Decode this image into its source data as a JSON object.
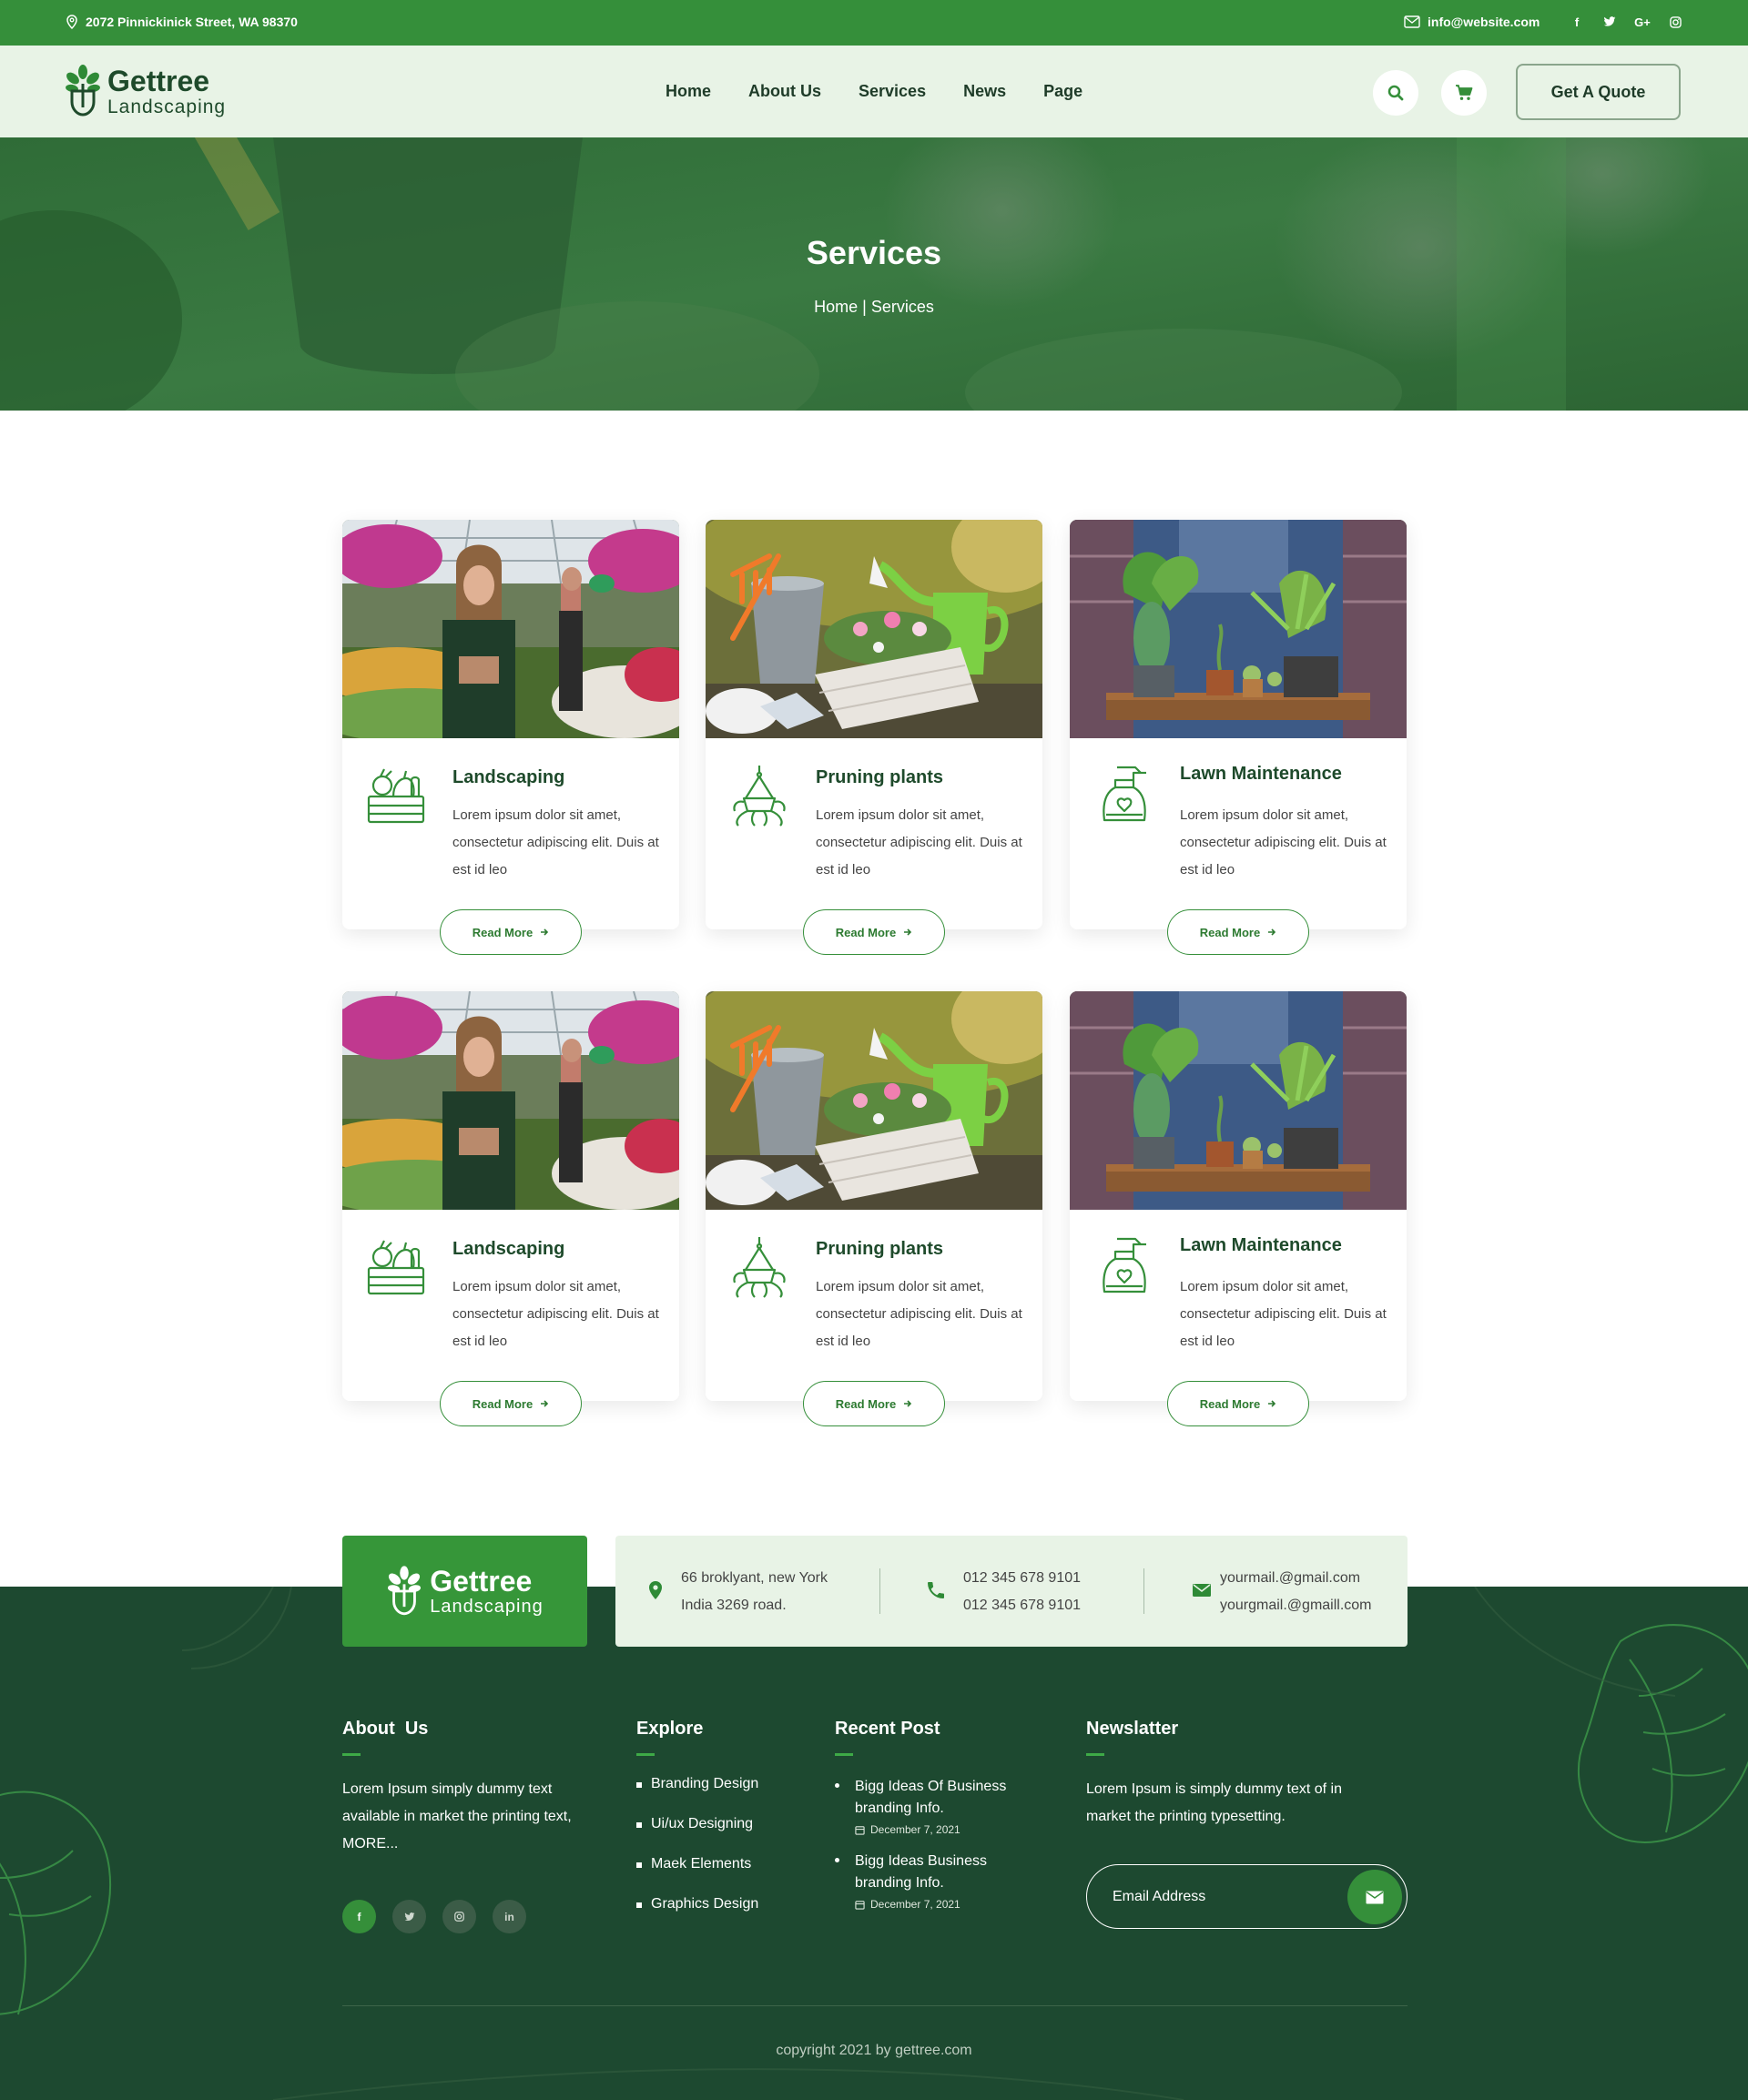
{
  "topbar": {
    "address": "2072 Pinnickinick Street, WA 98370",
    "email": "info@website.com",
    "socials": [
      "f",
      "t",
      "G+",
      "ig"
    ]
  },
  "brand": {
    "name": "Gettree",
    "tagline": "Landscaping"
  },
  "nav": {
    "items": [
      "Home",
      "About Us",
      "Services",
      "News",
      "Page"
    ],
    "quote_label": "Get A Quote",
    "search_icon": "search-icon",
    "cart_icon": "cart-icon"
  },
  "banner": {
    "title": "Services",
    "crumb_home": "Home",
    "crumb_sep": " | ",
    "crumb_current": "Services"
  },
  "services": [
    {
      "title": "Landscaping",
      "text": "Lorem ipsum dolor sit amet, consectetur adipiscing elit. Duis at est id leo",
      "button": "Read More",
      "icon": "garden-crate-icon"
    },
    {
      "title": "Pruning plants",
      "text": "Lorem ipsum dolor sit amet, consectetur adipiscing elit. Duis at est id leo",
      "button": "Read More",
      "icon": "hanging-plant-icon"
    },
    {
      "title": "Lawn Maintenance",
      "text": "Lorem ipsum dolor sit amet, consectetur adipiscing elit. Duis at est id leo",
      "button": "Read More",
      "icon": "spray-bottle-icon"
    },
    {
      "title": "Landscaping",
      "text": "Lorem ipsum dolor sit amet, consectetur adipiscing elit. Duis at est id leo",
      "button": "Read More",
      "icon": "garden-crate-icon"
    },
    {
      "title": "Pruning plants",
      "text": "Lorem ipsum dolor sit amet, consectetur adipiscing elit. Duis at est id leo",
      "button": "Read More",
      "icon": "hanging-plant-icon"
    },
    {
      "title": "Lawn Maintenance",
      "text": "Lorem ipsum dolor sit amet, consectetur adipiscing elit. Duis at est id leo",
      "button": "Read More",
      "icon": "spray-bottle-icon"
    }
  ],
  "contact": {
    "address_line1": "66 broklyant, new York",
    "address_line2": "India 3269 road.",
    "phone1": "012 345 678 9101",
    "phone2": "012 345 678 9101",
    "email1": "yourmail.@gmail.com",
    "email2": "yourgmail.@gmaill.com"
  },
  "footer": {
    "about": {
      "heading": "About  Us",
      "text": "Lorem Ipsum simply dummy text available in market the printing text, MORE..."
    },
    "social_icons": [
      "f",
      "t",
      "ig",
      "in"
    ],
    "explore": {
      "heading": "Explore",
      "items": [
        "Branding Design",
        "Ui/ux Designing",
        "Maek Elements",
        "Graphics Design"
      ]
    },
    "recent": {
      "heading": "Recent Post",
      "posts": [
        {
          "title": "Bigg Ideas Of Business branding Info.",
          "date": "December 7, 2021"
        },
        {
          "title": "Bigg Ideas Business branding Info.",
          "date": "December 7, 2021"
        }
      ]
    },
    "newsletter": {
      "heading": "Newslatter",
      "text": "Lorem Ipsum is simply dummy text of in market the printing typesetting.",
      "placeholder": "Email Address"
    },
    "copyright": "copyright 2021 by gettree.com"
  },
  "colors": {
    "primary": "#358f3a",
    "dark": "#1d4930",
    "light": "#e8f3e6"
  }
}
